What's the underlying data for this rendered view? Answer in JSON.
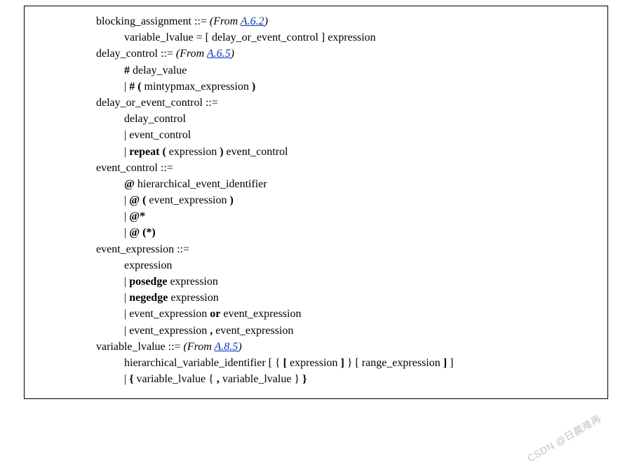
{
  "blocking_assignment": {
    "head": "blocking_assignment ::= ",
    "from_prefix": "(From ",
    "from_link": "A.6.2",
    "from_suffix": ")",
    "body1": "variable_lvalue = [ delay_or_event_control ] expression"
  },
  "delay_control": {
    "head": "delay_control ::= ",
    "from_prefix": "(From ",
    "from_link": "A.6.5",
    "from_suffix": ")",
    "b1_bold": "#",
    "b1_rest": " delay_value",
    "b2_pipe": "| ",
    "b2_bold1": "# (",
    "b2_mid": " mintypmax_expression ",
    "b2_bold2": ")"
  },
  "delay_or_event_control": {
    "head": "delay_or_event_control ::=",
    "b1": "delay_control",
    "b2": "| event_control",
    "b3_pipe": "| ",
    "b3_bold1": "repeat (",
    "b3_mid": " expression ",
    "b3_bold2": ")",
    "b3_rest": " event_control"
  },
  "event_control": {
    "head": "event_control ::=",
    "b1_bold": "@",
    "b1_rest": " hierarchical_event_identifier",
    "b2_pipe": "| ",
    "b2_bold1": "@ (",
    "b2_mid": " event_expression ",
    "b2_bold2": ")",
    "b3_pipe": "| ",
    "b3_bold": "@*",
    "b4_pipe": "| ",
    "b4_bold": "@ (*)"
  },
  "event_expression": {
    "head": "event_expression ::=",
    "b1": "expression",
    "b2_pipe": "| ",
    "b2_bold": "posedge",
    "b2_rest": " expression",
    "b3_pipe": "| ",
    "b3_bold": "negedge",
    "b3_rest": " expression",
    "b4": "| event_expression ",
    "b4_bold": "or",
    "b4_rest": " event_expression",
    "b5": "| event_expression ",
    "b5_bold": ",",
    "b5_rest": " event_expression"
  },
  "variable_lvalue": {
    "head": "variable_lvalue ::= ",
    "from_prefix": "(From ",
    "from_link": "A.8.5",
    "from_suffix": ")",
    "b1_a": "hierarchical_variable_identifier [ { ",
    "b1_bold1": "[",
    "b1_b": " expression ",
    "b1_bold2": "]",
    "b1_c": " } [ range_expression ",
    "b1_bold3": "]",
    "b1_d": " ]",
    "b2_pipe": "| ",
    "b2_bold1": "{",
    "b2_a": " variable_lvalue { ",
    "b2_bold2": ",",
    "b2_b": " variable_lvalue } ",
    "b2_bold3": "}"
  },
  "watermark_prefix": "CSDN @",
  "watermark_text": "日晨难再"
}
